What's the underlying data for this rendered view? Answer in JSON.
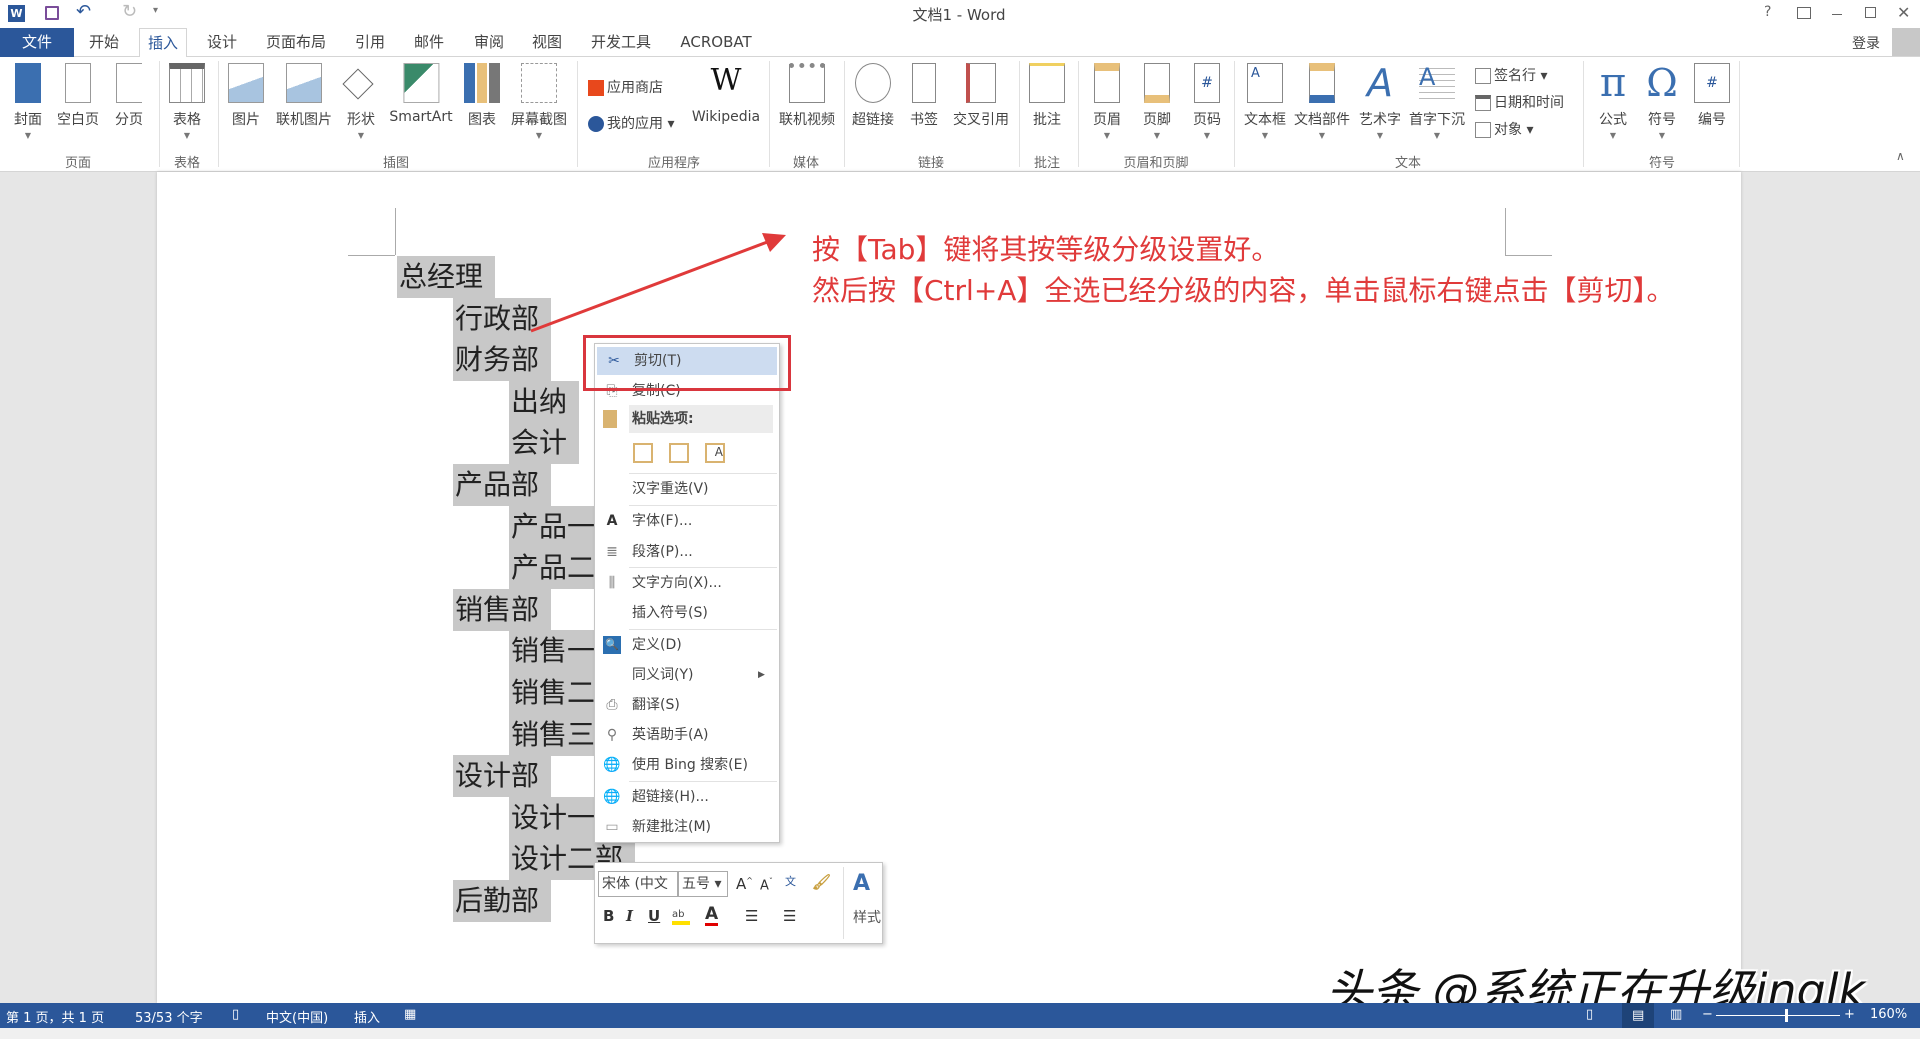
{
  "window": {
    "title": "文档1 - Word",
    "help": "?",
    "signin": "登录"
  },
  "tabs": [
    "文件",
    "开始",
    "插入",
    "设计",
    "页面布局",
    "引用",
    "邮件",
    "审阅",
    "视图",
    "开发工具",
    "ACROBAT"
  ],
  "active_tab": "插入",
  "ribbon": {
    "buttons": [
      "封面",
      "空白页",
      "分页",
      "表格",
      "图片",
      "联机图片",
      "形状",
      "SmartArt",
      "图表",
      "屏幕截图",
      "Wikipedia",
      "联机视频",
      "超链接",
      "书签",
      "交叉引用",
      "批注",
      "页眉",
      "页脚",
      "页码",
      "文本框",
      "文档部件",
      "艺术字",
      "首字下沉",
      "公式",
      "符号",
      "编号"
    ],
    "small": {
      "store": "应用商店",
      "myapps": "我的应用",
      "signature": "签名行",
      "datetime": "日期和时间",
      "object": "对象"
    },
    "groups": [
      "页面",
      "表格",
      "插图",
      "应用程序",
      "媒体",
      "链接",
      "批注",
      "页眉和页脚",
      "文本",
      "符号"
    ]
  },
  "document": {
    "lines": [
      {
        "text": "总经理",
        "level": 0
      },
      {
        "text": "行政部",
        "level": 1
      },
      {
        "text": "财务部",
        "level": 1
      },
      {
        "text": "出纳",
        "level": 2
      },
      {
        "text": "会计",
        "level": 2
      },
      {
        "text": "产品部",
        "level": 1
      },
      {
        "text": "产品一部",
        "level": 2
      },
      {
        "text": "产品二部",
        "level": 2
      },
      {
        "text": "销售部",
        "level": 1
      },
      {
        "text": "销售一部",
        "level": 2
      },
      {
        "text": "销售二部",
        "level": 2
      },
      {
        "text": "销售三部",
        "level": 2
      },
      {
        "text": "设计部",
        "level": 1
      },
      {
        "text": "设计一部",
        "level": 2
      },
      {
        "text": "设计二部",
        "level": 2
      },
      {
        "text": "后勤部",
        "level": 1
      }
    ]
  },
  "annotation": {
    "line1": "按【Tab】键将其按等级分级设置好。",
    "line2": "然后按【Ctrl+A】全选已经分级的内容，单击鼠标右键点击【剪切】。",
    "color": "#e03a3a"
  },
  "context_menu": {
    "cut": "剪切(T)",
    "copy": "复制(C)",
    "paste_options": "粘贴选项:",
    "reconvert": "汉字重选(V)",
    "font": "字体(F)...",
    "paragraph": "段落(P)...",
    "text_direction": "文字方向(X)...",
    "insert_symbol": "插入符号(S)",
    "define": "定义(D)",
    "synonyms": "同义词(Y)",
    "translate": "翻译(S)",
    "english_assistant": "英语助手(A)",
    "bing_search": "使用 Bing 搜索(E)",
    "hyperlink": "超链接(H)...",
    "new_comment": "新建批注(M)"
  },
  "mini_toolbar": {
    "font": "宋体 (中文",
    "size": "五号",
    "styles": "样式",
    "bold": "B",
    "italic": "I",
    "underline": "U"
  },
  "status": {
    "page": "第 1 页，共 1 页",
    "words": "53/53 个字",
    "language": "中文(中国)",
    "mode": "插入",
    "zoom": "160%",
    "zoom_percent": 160
  },
  "watermark": "头条 @系统正在升级inglk",
  "colors": {
    "accent": "#2b579a",
    "highlight": "#c8c8c8",
    "red": "#e03a3a"
  }
}
